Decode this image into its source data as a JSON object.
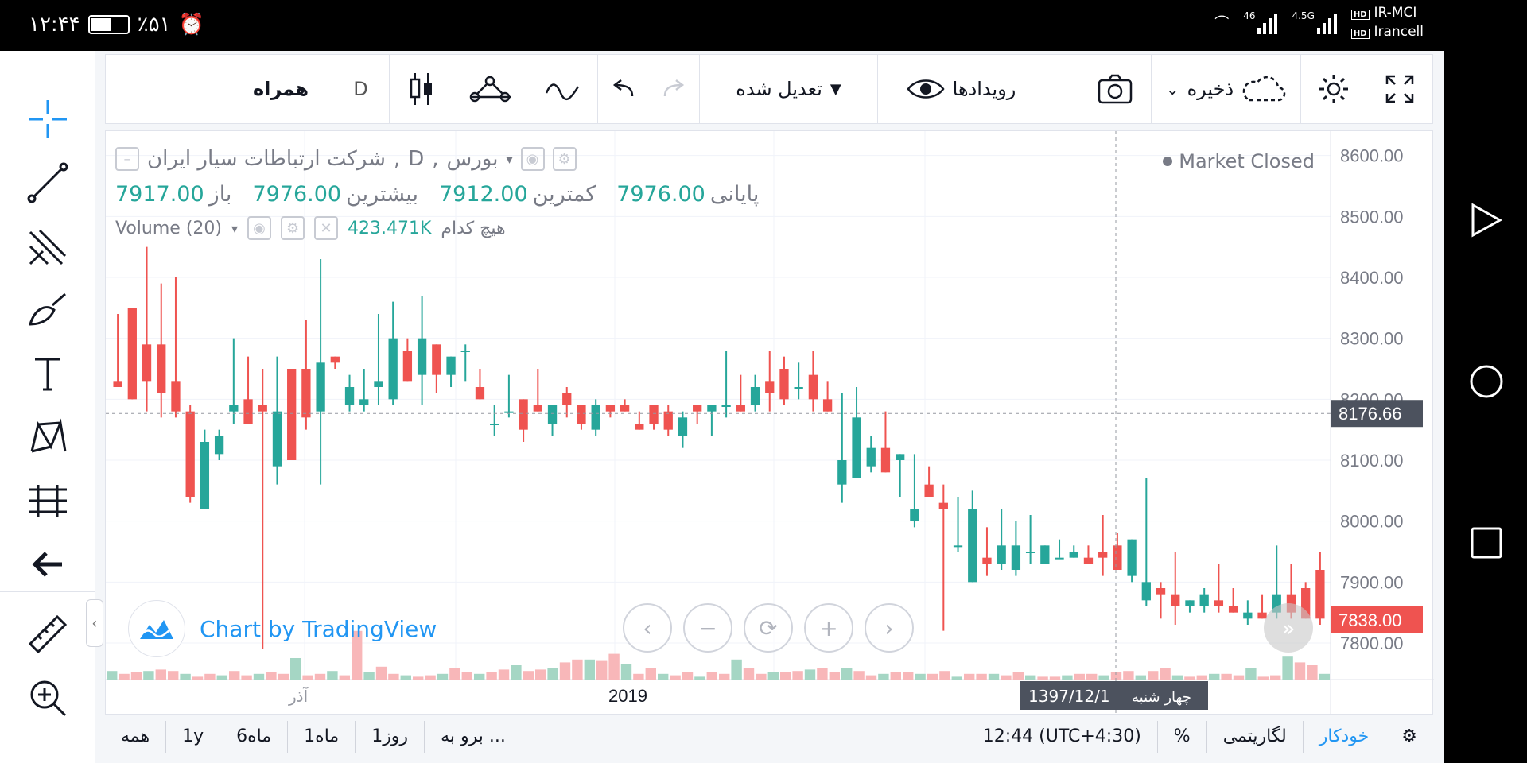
{
  "status_bar": {
    "time": "۱۲:۴۴",
    "battery": "٪۵۱",
    "carrier1_tag": "HD",
    "carrier1": "IR-MCI",
    "carrier2_tag": "HD",
    "carrier2": "Irancell",
    "net1": "46",
    "net2": "4.5G"
  },
  "toolbar": {
    "compare_label": "همراه",
    "interval_label": "D",
    "adjusted_label": "تعدیل شده",
    "events_label": "رویدادها",
    "save_label": "ذخیره"
  },
  "legend": {
    "symbol_title": "شرکت ارتباطات سیار ایران",
    "interval": "D",
    "exchange": "بورس",
    "sep": ",",
    "open_label": "باز",
    "open_value": "7917.00",
    "high_label": "بیشترین",
    "high_value": "7976.00",
    "low_label": "کمترین",
    "low_value": "7912.00",
    "close_label": "پایانی",
    "close_value": "7976.00",
    "volume_label": "Volume (20)",
    "volume_value": "423.471K",
    "volume_ma": "هیچ کدام",
    "market_status": "Market Closed"
  },
  "branding": {
    "text": "Chart by TradingView"
  },
  "bottom_bar": {
    "ranges": [
      "همه",
      "1y",
      "6ماه",
      "1ماه",
      "1روز",
      "برو به ..."
    ],
    "time": "12:44 (UTC+4:30)",
    "percent": "%",
    "log": "لگاریتمی",
    "auto": "خودکار"
  },
  "colors": {
    "up": "#26a69a",
    "down": "#ef5350",
    "up_volume": "#a5d6c4",
    "down_volume": "#f8b7b9",
    "accent": "#2196f3"
  },
  "chart_data": {
    "type": "candlestick",
    "title": "شرکت ارتباطات سیار ایران , D, بورس",
    "ylim": [
      7740,
      8640
    ],
    "y_ticks": [
      8600,
      8500,
      8400,
      8300,
      8200,
      8100,
      8000,
      7900,
      7800
    ],
    "y_tick_labels": [
      "8600.00",
      "8500.00",
      "8400.00",
      "8300.00",
      "8200.00",
      "8100.00",
      "8000.00",
      "7900.00",
      "7800.00"
    ],
    "x_labels": [
      "آذر",
      "2019"
    ],
    "crosshair_price": "8176.66",
    "crosshair_date": "1397/12/1",
    "crosshair_day": "چهار شنبه",
    "last_price": "7838.00",
    "candles": [
      {
        "o": 8230,
        "h": 8340,
        "l": 8220,
        "c": 8220
      },
      {
        "o": 8350,
        "h": 8270,
        "l": 8200,
        "c": 8200
      },
      {
        "o": 8290,
        "h": 8450,
        "l": 8180,
        "c": 8230
      },
      {
        "o": 8290,
        "h": 8390,
        "l": 8170,
        "c": 8210
      },
      {
        "o": 8230,
        "h": 8400,
        "l": 8170,
        "c": 8180
      },
      {
        "o": 8180,
        "h": 8190,
        "l": 8030,
        "c": 8040
      },
      {
        "o": 8020,
        "h": 8150,
        "l": 8020,
        "c": 8130
      },
      {
        "o": 8110,
        "h": 8150,
        "l": 8100,
        "c": 8140
      },
      {
        "o": 8180,
        "h": 8300,
        "l": 8160,
        "c": 8190
      },
      {
        "o": 8200,
        "h": 8270,
        "l": 8160,
        "c": 8160
      },
      {
        "o": 8190,
        "h": 8250,
        "l": 7790,
        "c": 8180
      },
      {
        "o": 8090,
        "h": 8270,
        "l": 8060,
        "c": 8180
      },
      {
        "o": 8250,
        "h": 8250,
        "l": 8100,
        "c": 8100
      },
      {
        "o": 8250,
        "h": 8330,
        "l": 8150,
        "c": 8170
      },
      {
        "o": 8180,
        "h": 8430,
        "l": 8060,
        "c": 8260
      },
      {
        "o": 8270,
        "h": 8260,
        "l": 8250,
        "c": 8260
      },
      {
        "o": 8190,
        "h": 8240,
        "l": 8180,
        "c": 8220
      },
      {
        "o": 8190,
        "h": 8250,
        "l": 8180,
        "c": 8200
      },
      {
        "o": 8220,
        "h": 8340,
        "l": 8190,
        "c": 8230
      },
      {
        "o": 8200,
        "h": 8360,
        "l": 8190,
        "c": 8300
      },
      {
        "o": 8280,
        "h": 8300,
        "l": 8250,
        "c": 8230
      },
      {
        "o": 8240,
        "h": 8370,
        "l": 8190,
        "c": 8300
      },
      {
        "o": 8290,
        "h": 8290,
        "l": 8210,
        "c": 8240
      },
      {
        "o": 8240,
        "h": 8270,
        "l": 8220,
        "c": 8270
      },
      {
        "o": 8280,
        "h": 8290,
        "l": 8230,
        "c": 8280
      },
      {
        "o": 8220,
        "h": 8250,
        "l": 8210,
        "c": 8200
      },
      {
        "o": 8160,
        "h": 8190,
        "l": 8140,
        "c": 8160
      },
      {
        "o": 8180,
        "h": 8240,
        "l": 8170,
        "c": 8180
      },
      {
        "o": 8200,
        "h": 8200,
        "l": 8130,
        "c": 8150
      },
      {
        "o": 8190,
        "h": 8250,
        "l": 8180,
        "c": 8180
      },
      {
        "o": 8160,
        "h": 8180,
        "l": 8140,
        "c": 8190
      },
      {
        "o": 8210,
        "h": 8220,
        "l": 8170,
        "c": 8190
      },
      {
        "o": 8190,
        "h": 8180,
        "l": 8150,
        "c": 8160
      },
      {
        "o": 8150,
        "h": 8200,
        "l": 8140,
        "c": 8190
      },
      {
        "o": 8190,
        "h": 8190,
        "l": 8170,
        "c": 8180
      },
      {
        "o": 8190,
        "h": 8200,
        "l": 8180,
        "c": 8180
      },
      {
        "o": 8160,
        "h": 8180,
        "l": 8150,
        "c": 8150
      },
      {
        "o": 8190,
        "h": 8190,
        "l": 8150,
        "c": 8160
      },
      {
        "o": 8180,
        "h": 8190,
        "l": 8140,
        "c": 8150
      },
      {
        "o": 8140,
        "h": 8180,
        "l": 8120,
        "c": 8170
      },
      {
        "o": 8190,
        "h": 8190,
        "l": 8160,
        "c": 8180
      },
      {
        "o": 8180,
        "h": 8190,
        "l": 8140,
        "c": 8190
      },
      {
        "o": 8190,
        "h": 8280,
        "l": 8170,
        "c": 8190
      },
      {
        "o": 8190,
        "h": 8240,
        "l": 8180,
        "c": 8180
      },
      {
        "o": 8190,
        "h": 8240,
        "l": 8180,
        "c": 8220
      },
      {
        "o": 8230,
        "h": 8280,
        "l": 8180,
        "c": 8210
      },
      {
        "o": 8250,
        "h": 8270,
        "l": 8190,
        "c": 8200
      },
      {
        "o": 8220,
        "h": 8260,
        "l": 8200,
        "c": 8220
      },
      {
        "o": 8240,
        "h": 8280,
        "l": 8180,
        "c": 8200
      },
      {
        "o": 8200,
        "h": 8230,
        "l": 8190,
        "c": 8180
      },
      {
        "o": 8060,
        "h": 8210,
        "l": 8030,
        "c": 8100
      },
      {
        "o": 8070,
        "h": 8220,
        "l": 8070,
        "c": 8170
      },
      {
        "o": 8090,
        "h": 8140,
        "l": 8080,
        "c": 8120
      },
      {
        "o": 8120,
        "h": 8180,
        "l": 8110,
        "c": 8080
      },
      {
        "o": 8100,
        "h": 8110,
        "l": 8040,
        "c": 8110
      },
      {
        "o": 8000,
        "h": 8110,
        "l": 7990,
        "c": 8020
      },
      {
        "o": 8060,
        "h": 8090,
        "l": 8060,
        "c": 8040
      },
      {
        "o": 8030,
        "h": 8060,
        "l": 7820,
        "c": 8020
      },
      {
        "o": 7960,
        "h": 8040,
        "l": 7950,
        "c": 7960
      },
      {
        "o": 7900,
        "h": 8050,
        "l": 7900,
        "c": 8020
      },
      {
        "o": 7940,
        "h": 7990,
        "l": 7910,
        "c": 7930
      },
      {
        "o": 7930,
        "h": 8020,
        "l": 7920,
        "c": 7960
      },
      {
        "o": 7920,
        "h": 8000,
        "l": 7910,
        "c": 7960
      },
      {
        "o": 7950,
        "h": 8010,
        "l": 7930,
        "c": 7950
      },
      {
        "o": 7930,
        "h": 7960,
        "l": 7930,
        "c": 7960
      },
      {
        "o": 7940,
        "h": 7970,
        "l": 7940,
        "c": 7940
      },
      {
        "o": 7940,
        "h": 7960,
        "l": 7940,
        "c": 7950
      },
      {
        "o": 7940,
        "h": 7960,
        "l": 7930,
        "c": 7930
      },
      {
        "o": 7950,
        "h": 8010,
        "l": 7910,
        "c": 7940
      },
      {
        "o": 7960,
        "h": 7980,
        "l": 7940,
        "c": 7920
      },
      {
        "o": 7910,
        "h": 7970,
        "l": 7900,
        "c": 7970
      },
      {
        "o": 7870,
        "h": 8070,
        "l": 7860,
        "c": 7900
      },
      {
        "o": 7890,
        "h": 7900,
        "l": 7840,
        "c": 7880
      },
      {
        "o": 7880,
        "h": 7950,
        "l": 7830,
        "c": 7860
      },
      {
        "o": 7860,
        "h": 7870,
        "l": 7850,
        "c": 7870
      },
      {
        "o": 7860,
        "h": 7890,
        "l": 7850,
        "c": 7880
      },
      {
        "o": 7870,
        "h": 7930,
        "l": 7850,
        "c": 7860
      },
      {
        "o": 7860,
        "h": 7890,
        "l": 7850,
        "c": 7850
      },
      {
        "o": 7840,
        "h": 7870,
        "l": 7830,
        "c": 7850
      },
      {
        "o": 7850,
        "h": 7880,
        "l": 7840,
        "c": 7840
      },
      {
        "o": 7850,
        "h": 7960,
        "l": 7840,
        "c": 7880
      },
      {
        "o": 7880,
        "h": 7930,
        "l": 7840,
        "c": 7850
      },
      {
        "o": 7890,
        "h": 7900,
        "l": 7840,
        "c": 7840
      },
      {
        "o": 7920,
        "h": 7950,
        "l": 7830,
        "c": 7840
      }
    ],
    "volumes": [
      0.3,
      0.2,
      0.25,
      0.3,
      0.35,
      0.3,
      0.2,
      0.1,
      0.2,
      0.15,
      0.3,
      0.15,
      0.2,
      0.25,
      0.2,
      0.75,
      0.15,
      0.2,
      0.3,
      0.15,
      1.7,
      0.25,
      0.45,
      0.2,
      0.15,
      0.1,
      0.15,
      0.2,
      0.4,
      0.25,
      0.2,
      0.25,
      0.35,
      0.5,
      0.3,
      0.35,
      0.4,
      0.6,
      0.7,
      0.7,
      0.65,
      0.9,
      0.55,
      0.2,
      0.4,
      0.2,
      0.15,
      0.25,
      0.1,
      0.25,
      0.2,
      0.7,
      0.4,
      0.2,
      0.25,
      0.25,
      0.3,
      0.35,
      0.4,
      0.25,
      0.4,
      0.3,
      0.15,
      0.2,
      0.25,
      0.25,
      0.2,
      0.2,
      0.3,
      0.1,
      0.2,
      0.2,
      0.2,
      0.15,
      0.25,
      0.15,
      0.1,
      0.1,
      0.15,
      0.2,
      0.2,
      0.15,
      0.25,
      0.3,
      0.15,
      0.3,
      0.4,
      0.15,
      0.1,
      0.15,
      0.2,
      0.2,
      0.15,
      0.4,
      0.1,
      0.15,
      0.8,
      0.6,
      0.5,
      0.2
    ]
  }
}
